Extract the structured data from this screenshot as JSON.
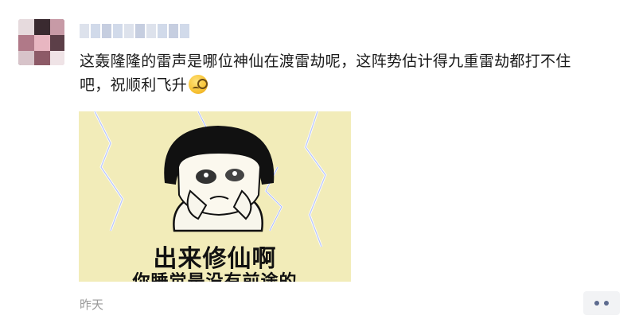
{
  "post": {
    "text_line1": "这轰隆隆的雷声是哪位神仙在渡雷劫呢，这阵势估计得九重雷劫都打不住",
    "text_line2": "吧，祝顺利飞升",
    "emoji_icon": "nerd-face-icon"
  },
  "image": {
    "caption_line1": "出来修仙啊",
    "caption_line2": "你睡觉是没有前途的"
  },
  "footer": {
    "timestamp": "昨天",
    "more_icon": "more-dots-icon"
  },
  "colors": {
    "meme_background": "#f2ecb9",
    "more_dots": "#5d6b8f",
    "timestamp": "#9a9a9a"
  }
}
